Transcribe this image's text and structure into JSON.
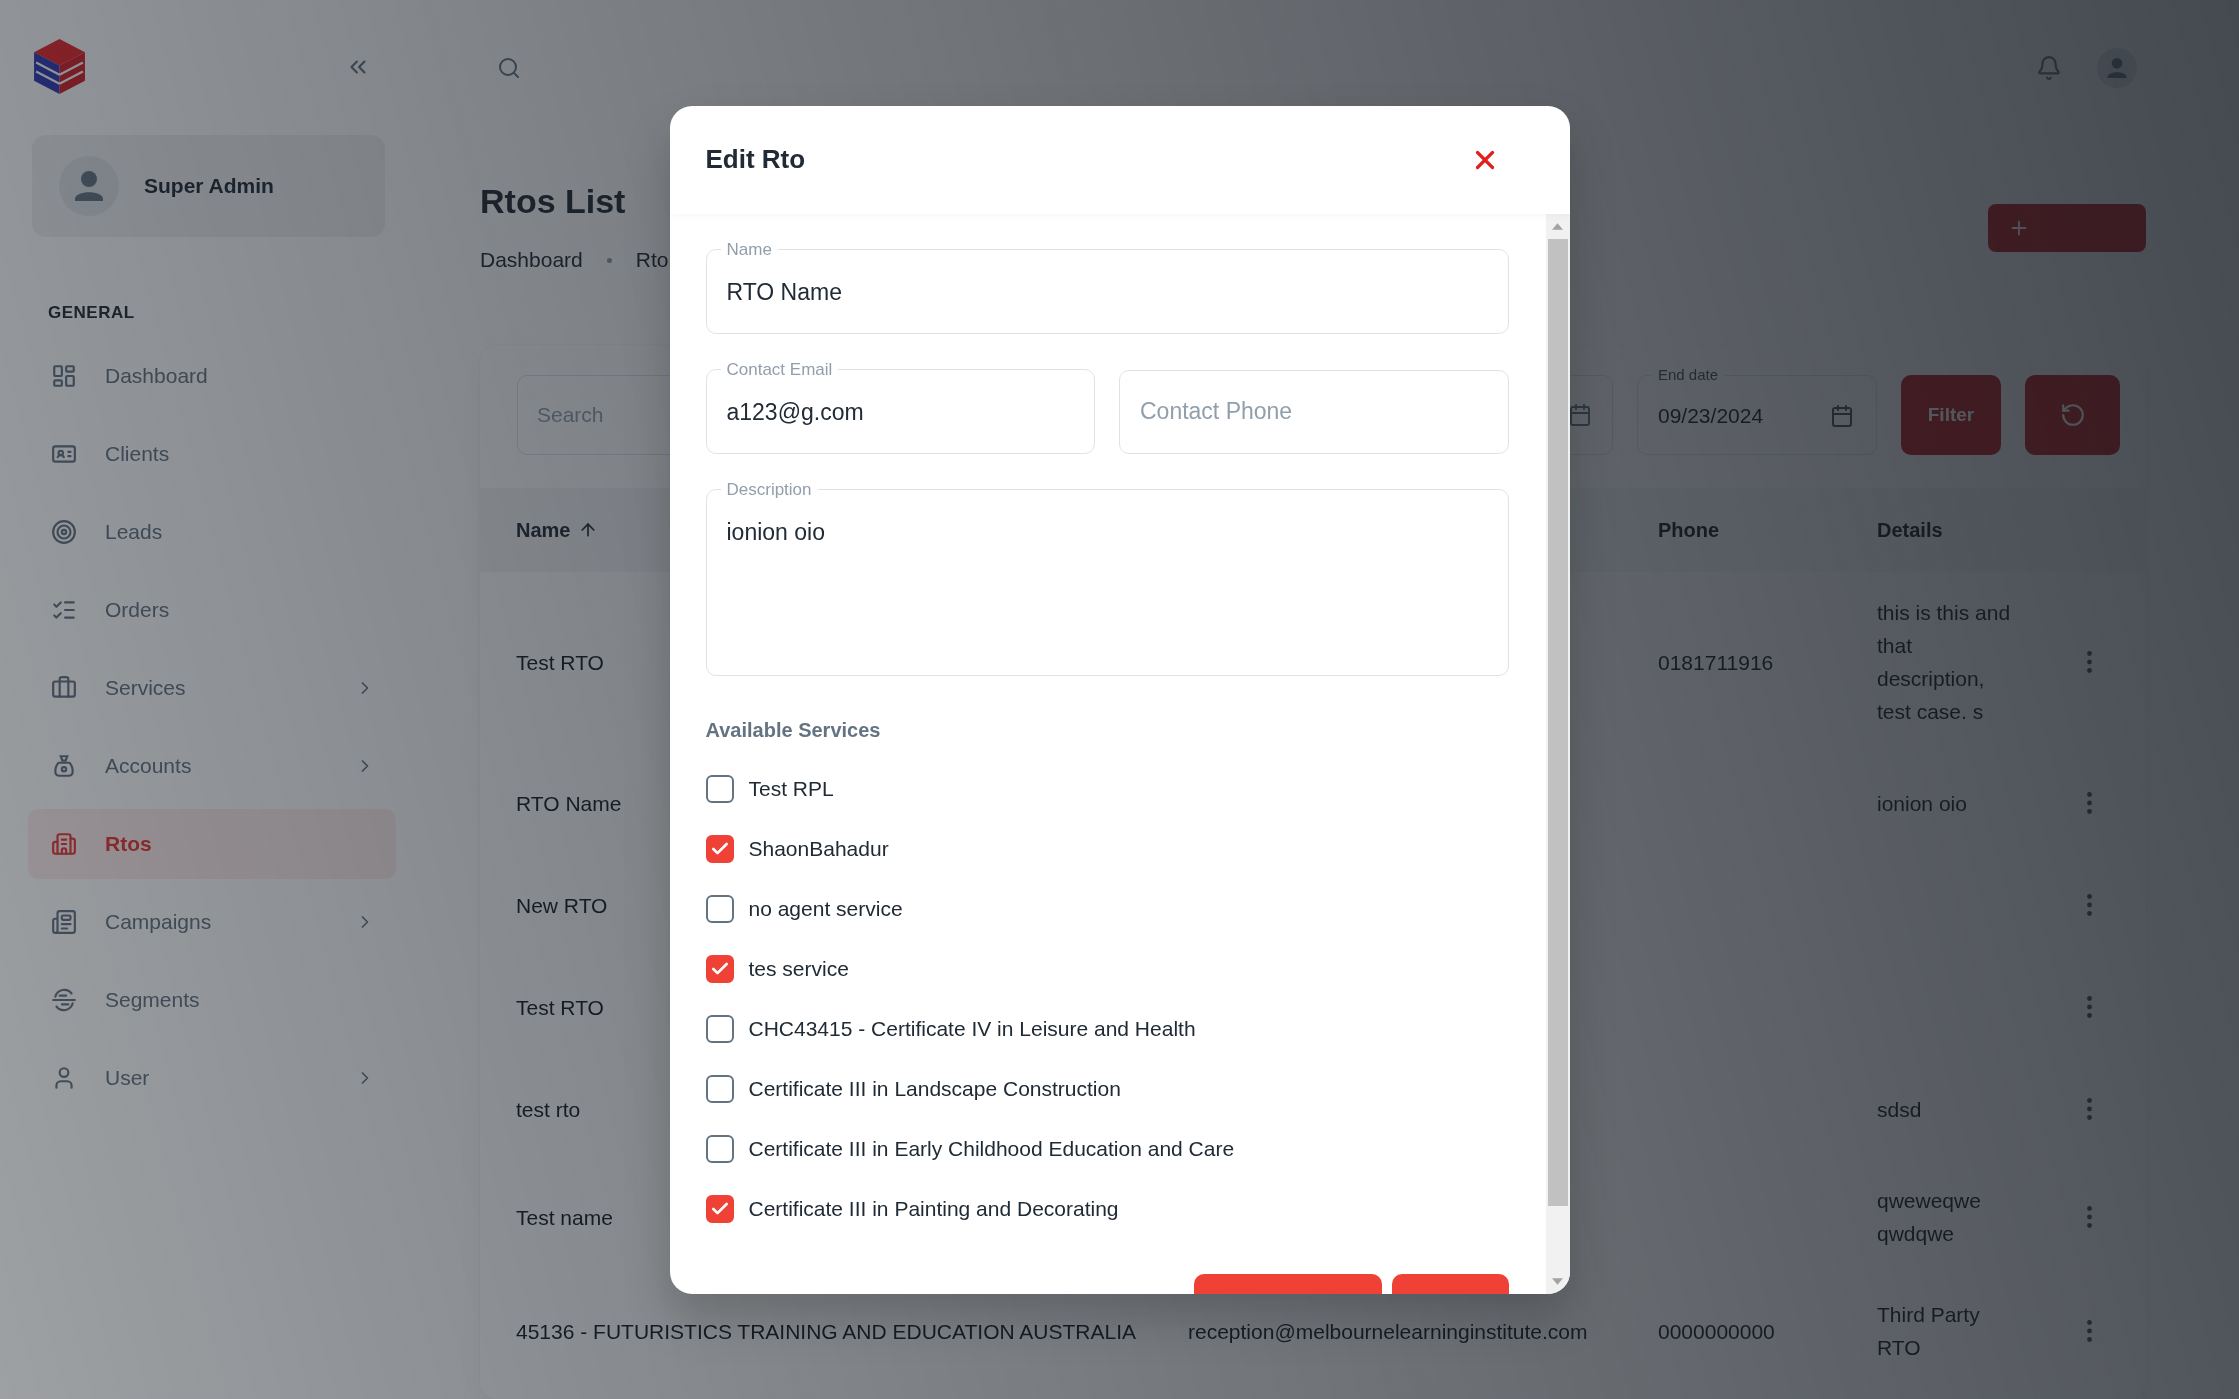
{
  "sidebar": {
    "user": {
      "name": "Super Admin"
    },
    "section_title": "GENERAL",
    "items": [
      {
        "label": "Dashboard",
        "selected": false,
        "has_submenu": false
      },
      {
        "label": "Clients",
        "selected": false,
        "has_submenu": false
      },
      {
        "label": "Leads",
        "selected": false,
        "has_submenu": false
      },
      {
        "label": "Orders",
        "selected": false,
        "has_submenu": false
      },
      {
        "label": "Services",
        "selected": false,
        "has_submenu": true
      },
      {
        "label": "Accounts",
        "selected": false,
        "has_submenu": true
      },
      {
        "label": "Rtos",
        "selected": true,
        "has_submenu": false
      },
      {
        "label": "Campaigns",
        "selected": false,
        "has_submenu": true
      },
      {
        "label": "Segments",
        "selected": false,
        "has_submenu": false
      },
      {
        "label": "User",
        "selected": false,
        "has_submenu": true
      }
    ]
  },
  "page": {
    "title": "Rtos List",
    "breadcrumbs": [
      "Dashboard",
      "Rto"
    ]
  },
  "filters": {
    "search": {
      "placeholder": "Search"
    },
    "end_date": {
      "label": "End date",
      "value": "09/23/2024"
    },
    "filter_button": "Filter"
  },
  "table": {
    "columns": {
      "name": {
        "label": "Name",
        "sorted": true,
        "ascending": true
      },
      "phone": {
        "label": "Phone",
        "sorted": false
      },
      "details": {
        "label": "Details",
        "sorted": false
      }
    },
    "rows": [
      {
        "name": "Test RTO",
        "phone": "0181711916",
        "details": "this is this and that description, test case. s"
      },
      {
        "name": "RTO Name",
        "details": "ionion oio"
      },
      {
        "name": "New RTO"
      },
      {
        "name": "Test RTO"
      },
      {
        "name": "test rto",
        "details": "sdsd"
      },
      {
        "name": "Test name",
        "details": "qweweqwe qwdqwe"
      },
      {
        "name": "45136 - FUTURISTICS TRAINING AND EDUCATION AUSTRALIA",
        "column_2": "reception@melbournelearninginstitute.com",
        "phone": "0000000000",
        "details": "Third Party RTO"
      }
    ]
  },
  "modal": {
    "title": "Edit Rto",
    "fields": [
      {
        "kind": "text",
        "label": "Name",
        "value": "RTO Name"
      },
      {
        "kind": "email",
        "label": "Contact Email",
        "value": "a123@g.com"
      },
      {
        "kind": "phone",
        "placeholder": "Contact Phone"
      },
      {
        "kind": "textarea",
        "label": "Description",
        "value": "ionion oio"
      }
    ],
    "services_title": "Available Services",
    "services": [
      {
        "label": "Test RPL",
        "checked": false
      },
      {
        "label": "ShaonBahadur",
        "checked": true
      },
      {
        "label": "no agent service",
        "checked": false
      },
      {
        "label": "tes service",
        "checked": true
      },
      {
        "label": "CHC43415 - Certificate IV in Leisure and Health",
        "checked": false
      },
      {
        "label": "Certificate III in Landscape Construction",
        "checked": false
      },
      {
        "label": "Certificate III in Early Childhood Education and Care",
        "checked": false
      },
      {
        "label": "Certificate III in Painting and Decorating",
        "checked": true
      }
    ]
  }
}
